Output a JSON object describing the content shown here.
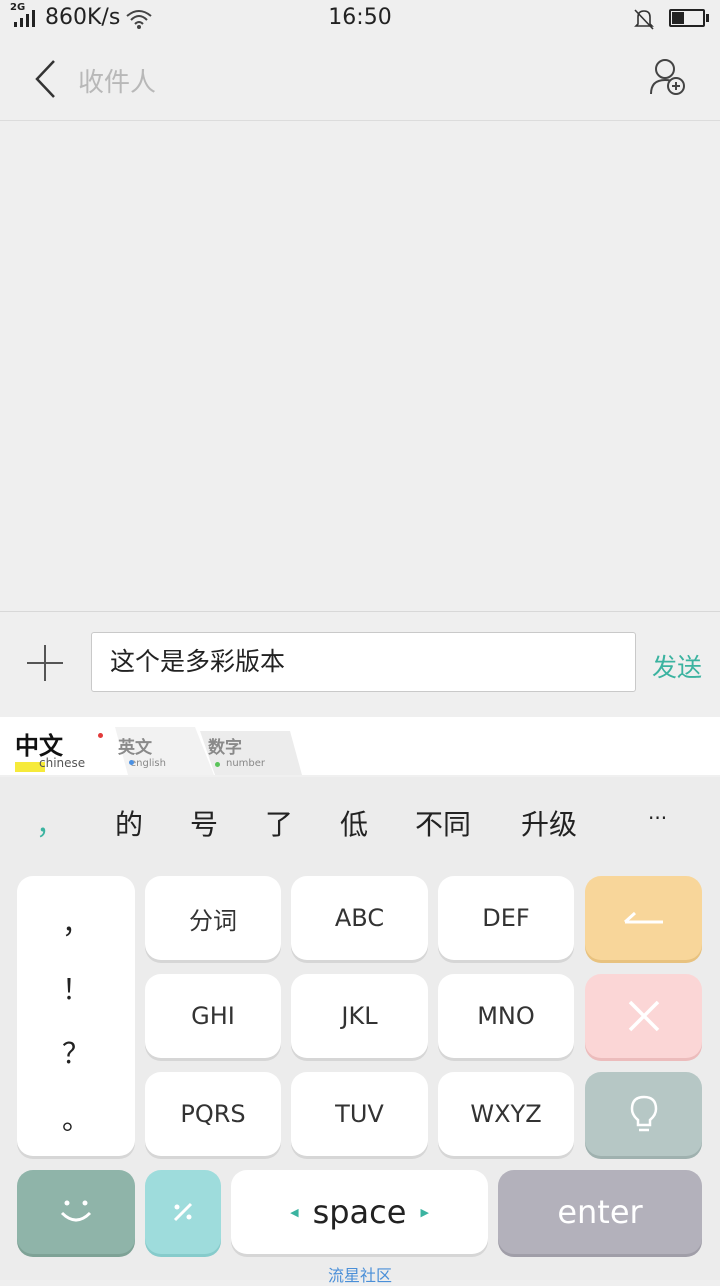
{
  "status_bar": {
    "network_type": "2G",
    "speed": "860K/s",
    "time": "16:50"
  },
  "header": {
    "title_placeholder": "收件人"
  },
  "compose": {
    "text": "这个是多彩版本",
    "send_label": "发送"
  },
  "keyboard": {
    "tabs": [
      {
        "label": "中文",
        "sub": "chinese"
      },
      {
        "label": "英文",
        "sub": "english"
      },
      {
        "label": "数字",
        "sub": "number"
      }
    ],
    "candidates": [
      "，",
      "的",
      "号",
      "了",
      "低",
      "不同",
      "升级",
      "···"
    ],
    "symbols": [
      "，",
      "！",
      "？",
      "。"
    ],
    "keys": {
      "fenci": "分词",
      "abc": "ABC",
      "def": "DEF",
      "ghi": "GHI",
      "jkl": "JKL",
      "mno": "MNO",
      "pqrs": "PQRS",
      "tuv": "TUV",
      "wxyz": "WXYZ",
      "space": "space",
      "enter": "enter"
    },
    "footer": "流星社区"
  },
  "colors": {
    "accent_green": "#3bb3a0",
    "backspace_key": "#f8d69a",
    "clear_key": "#fbd6d6",
    "bulb_key": "#b6c7c5",
    "emoji_key": "#8fb4a9",
    "symbol_key": "#9edcdc",
    "enter_key": "#b3b1bb"
  }
}
